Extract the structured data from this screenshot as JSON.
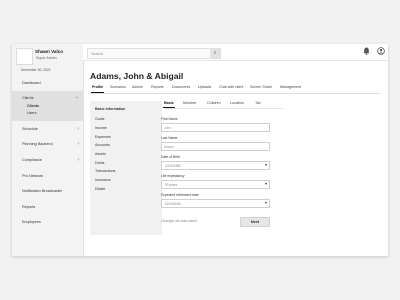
{
  "user": {
    "name": "Shawn Valco",
    "role": "Super Admin",
    "date": "November 30, 2021"
  },
  "sidebar": {
    "items": [
      {
        "label": "Dashboard",
        "chevron": ""
      },
      {
        "label": "Clients",
        "chevron": "⌄",
        "subitems": [
          "Clients",
          "Users"
        ]
      },
      {
        "label": "Schedule",
        "chevron": "›"
      },
      {
        "label": "Planning Backend",
        "chevron": "›"
      },
      {
        "label": "Compliance",
        "chevron": "›"
      },
      {
        "label": "Pro Network",
        "chevron": ""
      },
      {
        "label": "Notification Broadcaster",
        "chevron": ""
      },
      {
        "label": "Reports",
        "chevron": ""
      },
      {
        "label": "Employees",
        "chevron": ""
      }
    ]
  },
  "search": {
    "placeholder": "Search",
    "button_icon": "⌕"
  },
  "topbar": {
    "bell_icon": "bell-icon",
    "account_icon": "account-icon",
    "bell_glyph": "🔔",
    "account_glyph": "◯"
  },
  "page": {
    "title": "Adams, John & Abigail"
  },
  "tabs": [
    "Profile",
    "Scenarios",
    "Advice",
    "Reports",
    "Documents",
    "Uploads",
    "Chat with client",
    "Screen Share",
    "Management"
  ],
  "left_panel": {
    "heading": "Basic Information",
    "items": [
      "Goals",
      "Income",
      "Expenses",
      "Accounts",
      "Assets",
      "Debts",
      "Transactions",
      "Insurance",
      "Estate"
    ]
  },
  "subtabs": [
    "Basic",
    "Member",
    "Children",
    "Location",
    "Tax"
  ],
  "form": {
    "first_name": {
      "label": "First Name",
      "placeholder": "John"
    },
    "last_name": {
      "label": "Last Name",
      "placeholder": "Adams"
    },
    "dob": {
      "label": "Date of Birth",
      "value": "10/10/1980"
    },
    "life_expectancy": {
      "label": "Life expectancy",
      "value": "90 years"
    },
    "retirement_date": {
      "label": "Expected retirement date",
      "value": "02/15/2040"
    },
    "saved_note": "Changes are auto saved",
    "next_label": "Next"
  },
  "colors": {
    "accent": "#111111",
    "sidebar_bg": "#f3f3f3",
    "active_nav": "#e0e0e0",
    "button_bg": "#e6e6e6"
  }
}
